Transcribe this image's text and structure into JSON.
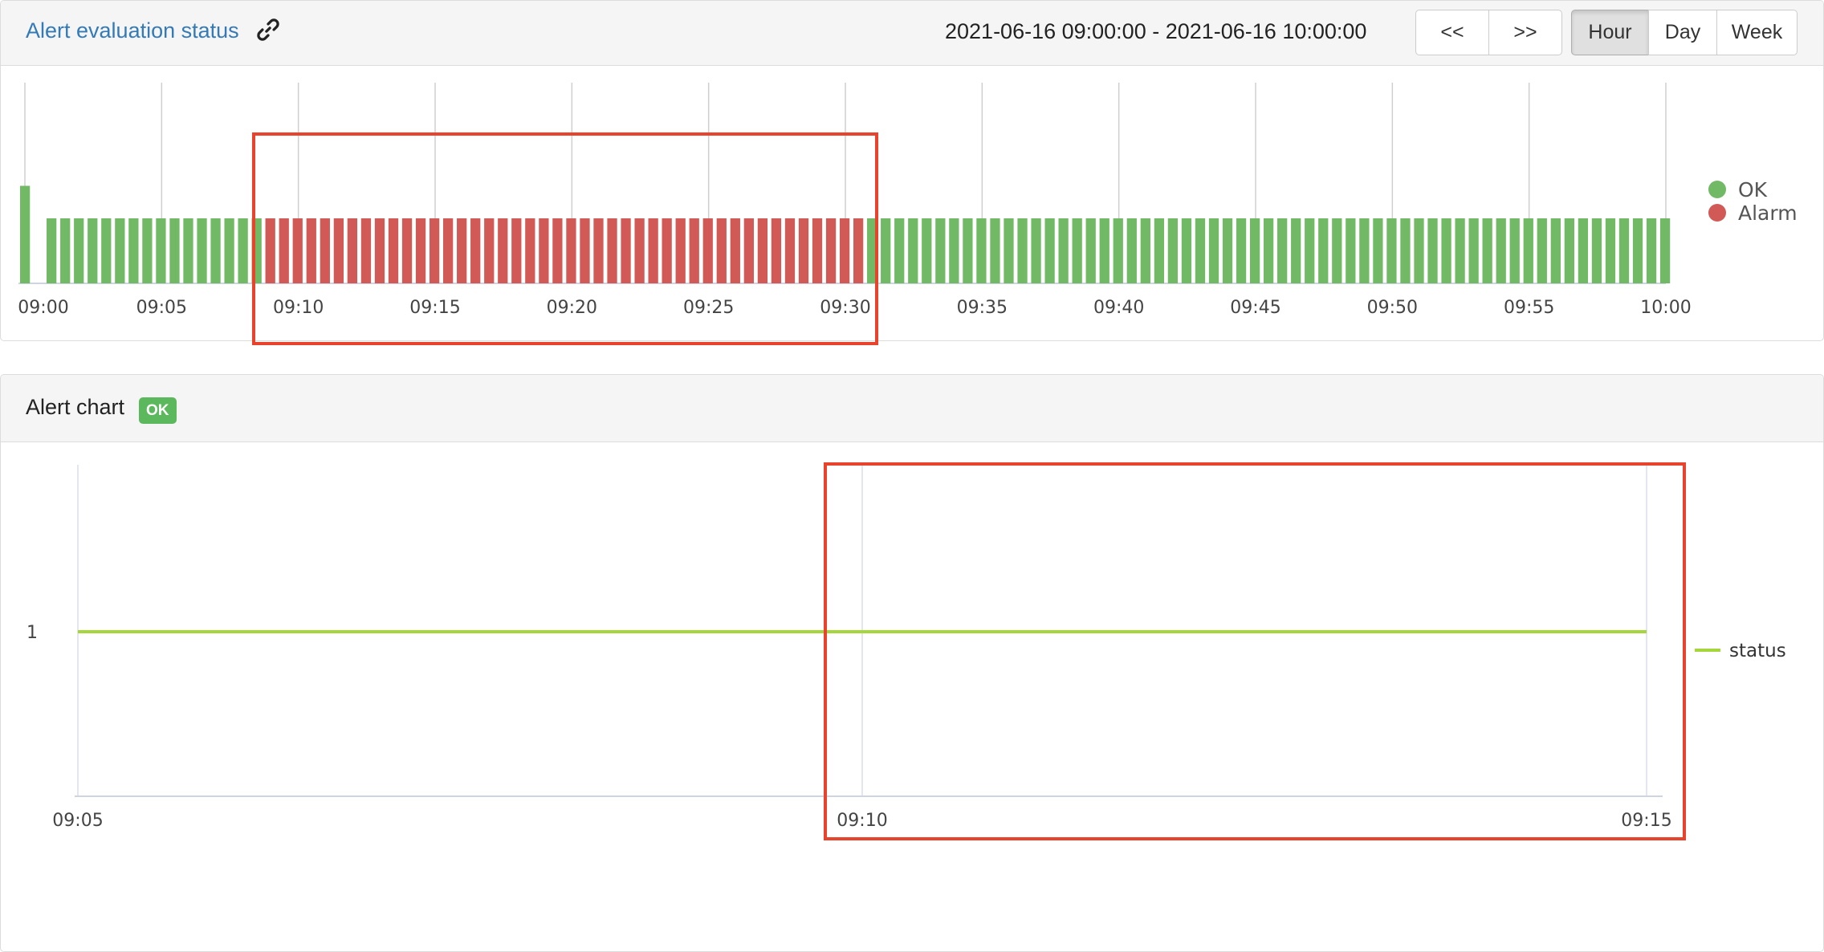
{
  "evaluation_panel": {
    "title": "Alert evaluation status",
    "link_icon": "link-icon",
    "time_range": "2021-06-16 09:00:00 - 2021-06-16 10:00:00",
    "nav": {
      "prev_label": "<<",
      "next_label": ">>"
    },
    "periods": [
      {
        "label": "Hour",
        "active": true
      },
      {
        "label": "Day",
        "active": false
      },
      {
        "label": "Week",
        "active": false
      }
    ]
  },
  "alert_chart_panel": {
    "title": "Alert chart",
    "badge": "OK"
  },
  "colors": {
    "ok": "#72b966",
    "alarm": "#d15a57",
    "status_line": "#a5d63c",
    "highlight": "#e8432d",
    "link": "#337ab7",
    "badge": "#5cb85c"
  },
  "chart_data": [
    {
      "type": "bar",
      "x_unit": "time (HH:MM)",
      "xlim": [
        "09:00",
        "10:00"
      ],
      "x_ticks": [
        "09:00",
        "09:05",
        "09:10",
        "09:15",
        "09:20",
        "09:25",
        "09:30",
        "09:35",
        "09:40",
        "09:45",
        "09:50",
        "09:55",
        "10:00"
      ],
      "legend": {
        "position": "right",
        "entries": [
          {
            "name": "OK",
            "color": "#72b966"
          },
          {
            "name": "Alarm",
            "color": "#d15a57"
          }
        ]
      },
      "grid": "vertical",
      "bins": {
        "interval_seconds": 30,
        "first_bar_time": "09:00",
        "last_bar_time": "09:59:30",
        "count": 120
      },
      "segments": [
        {
          "from": "09:00:00",
          "to": "09:08:30",
          "state": "OK"
        },
        {
          "from": "09:08:30",
          "to": "09:30:30",
          "state": "Alarm"
        },
        {
          "from": "09:30:30",
          "to": "10:00:00",
          "state": "OK"
        }
      ],
      "first_bar_relative_height": 1.5,
      "bar_relative_height": 1.0
    },
    {
      "type": "line",
      "x_ticks": [
        "09:05",
        "09:10",
        "09:15"
      ],
      "xlim": [
        "09:05",
        "09:15"
      ],
      "y_ticks": [
        "1"
      ],
      "legend": {
        "position": "right",
        "entries": [
          {
            "name": "status",
            "color": "#a5d63c"
          }
        ]
      },
      "grid": "vertical",
      "series": [
        {
          "name": "status",
          "x": [
            "09:05",
            "09:15"
          ],
          "values": [
            1,
            1
          ]
        }
      ]
    }
  ]
}
